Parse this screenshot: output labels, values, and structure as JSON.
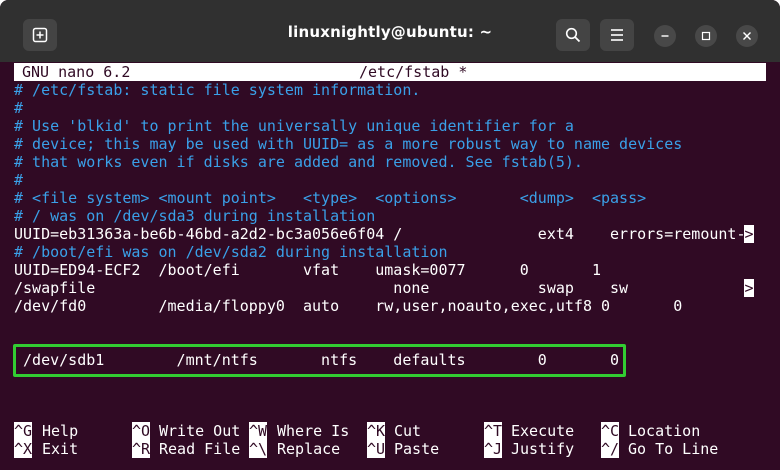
{
  "window": {
    "title": "linuxnightly@ubuntu: ~",
    "icons": {
      "new_tab": "new-tab-icon",
      "search": "search-icon",
      "menu": "hamburger-menu-icon",
      "minimize": "minimize-icon",
      "maximize": "maximize-icon",
      "close": "close-icon"
    },
    "colors": {
      "terminal_bg": "#300a24",
      "titlebar_bg": "#303030",
      "comment_color": "#3aa0e8",
      "highlight_border": "#32cd32"
    }
  },
  "nano": {
    "version": "GNU nano 6.2",
    "filename": "/etc/fstab *",
    "lines": [
      "# /etc/fstab: static file system information.",
      "#",
      "# Use 'blkid' to print the universally unique identifier for a",
      "# device; this may be used with UUID= as a more robust way to name devices",
      "# that works even if disks are added and removed. See fstab(5).",
      "#",
      "# <file system> <mount point>   <type>  <options>       <dump>  <pass>",
      "# / was on /dev/sda3 during installation",
      "UUID=eb31363a-be6b-46bd-a2d2-bc3a056e6f04 /               ext4    errors=remount-",
      "# /boot/efi was on /dev/sda2 during installation",
      "UUID=ED94-ECF2  /boot/efi       vfat    umask=0077      0       1",
      "/swapfile                                 none            swap    sw",
      "/dev/fd0        /media/floppy0  auto    rw,user,noauto,exec,utf8 0       0",
      "",
      " /dev/sdb1        /mnt/ntfs       ntfs    defaults        0       0"
    ],
    "overflow_marker": ">",
    "shortcuts": [
      {
        "key": "^G",
        "label": "Help"
      },
      {
        "key": "^O",
        "label": "Write Out"
      },
      {
        "key": "^W",
        "label": "Where Is"
      },
      {
        "key": "^K",
        "label": "Cut"
      },
      {
        "key": "^T",
        "label": "Execute"
      },
      {
        "key": "^C",
        "label": "Location"
      },
      {
        "key": "^X",
        "label": "Exit"
      },
      {
        "key": "^R",
        "label": "Read File"
      },
      {
        "key": "^\\",
        "label": "Replace"
      },
      {
        "key": "^U",
        "label": "Paste"
      },
      {
        "key": "^J",
        "label": "Justify"
      },
      {
        "key": "^/",
        "label": "Go To Line"
      }
    ]
  }
}
